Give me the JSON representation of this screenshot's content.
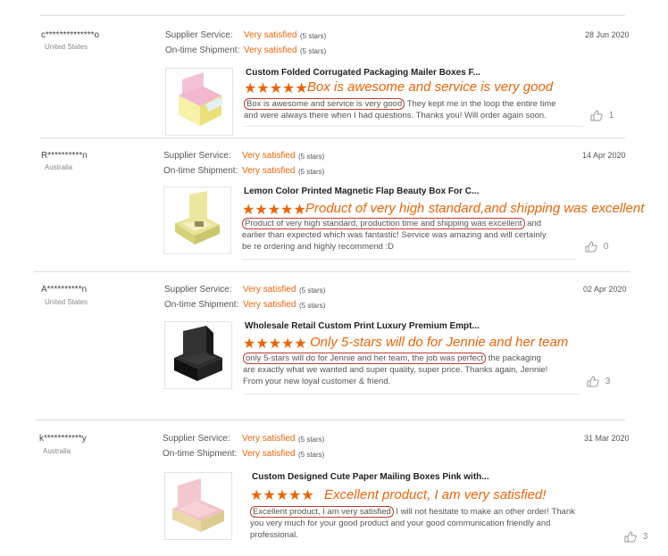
{
  "labels": {
    "supplier_service": "Supplier Service:",
    "on_time_shipment": "On-time Shipment:"
  },
  "reviews": [
    {
      "name": "c**************o",
      "country": "United States",
      "date": "28 Jun 2020",
      "supplier_value": "Very satisfied",
      "supplier_stars": "(5 stars)",
      "shipment_value": "Very satisfied",
      "shipment_stars": "(5 stars)",
      "product": "Custom Folded Corrugated Packaging Mailer Boxes F...",
      "stars": "★★★★★",
      "rating": 5,
      "headline": "Box is awesome and service is very good",
      "highlight": "Box is awesome and service is very good",
      "rest": " They kept me in the loop the entire time and were always there when I had questions. Thanks you! Will order again soon.",
      "likes": "1"
    },
    {
      "name": "R**********n",
      "country": "Australia",
      "date": "14 Apr 2020",
      "supplier_value": "Very satisfied",
      "supplier_stars": "(5 stars)",
      "shipment_value": "Very satisfied",
      "shipment_stars": "(5 stars)",
      "product": "Lemon Color Printed Magnetic Flap Beauty Box For C...",
      "stars": "★★★★★",
      "rating": 5,
      "headline": "Product of very high standard,and shipping was excellent",
      "highlight": "Product of very high standard, production time and shipping was excellent",
      "rest": " and earlier than expected which was fantastic! Service was amazing and will certainly be re ordering and highly recommend :D",
      "likes": "0"
    },
    {
      "name": "A**********n",
      "country": "United States",
      "date": "02 Apr 2020",
      "supplier_value": "Very satisfied",
      "supplier_stars": "(5 stars)",
      "shipment_value": "Very satisfied",
      "shipment_stars": "(5 stars)",
      "product": "Wholesale Retail Custom Print Luxury Premium Empt...",
      "stars": "★★★★★",
      "rating": 5,
      "headline": "Only 5-stars will do for Jennie and her team",
      "highlight": "only 5-stars will do for Jennie and her team, the job was perfect",
      "rest": " the packaging are exactly what we wanted and super quality, super price. Thanks again, Jennie! From your new loyal customer & friend.",
      "likes": "3"
    },
    {
      "name": "k***********y",
      "country": "Australia",
      "date": "31 Mar 2020",
      "supplier_value": "Very satisfied",
      "supplier_stars": "(5 stars)",
      "shipment_value": "Very satisfied",
      "shipment_stars": "(5 stars)",
      "product": "Custom Designed Cute Paper Mailing Boxes Pink with...",
      "stars": "★★★★★",
      "rating": 5,
      "headline": "Excellent product, I am very satisfied!",
      "highlight": "Excellent product, I am very satisfied",
      "rest": " I will not hesitate to make an other order! Thank you very much for your good product and your good communication friendly and professional.",
      "likes": "3"
    }
  ]
}
